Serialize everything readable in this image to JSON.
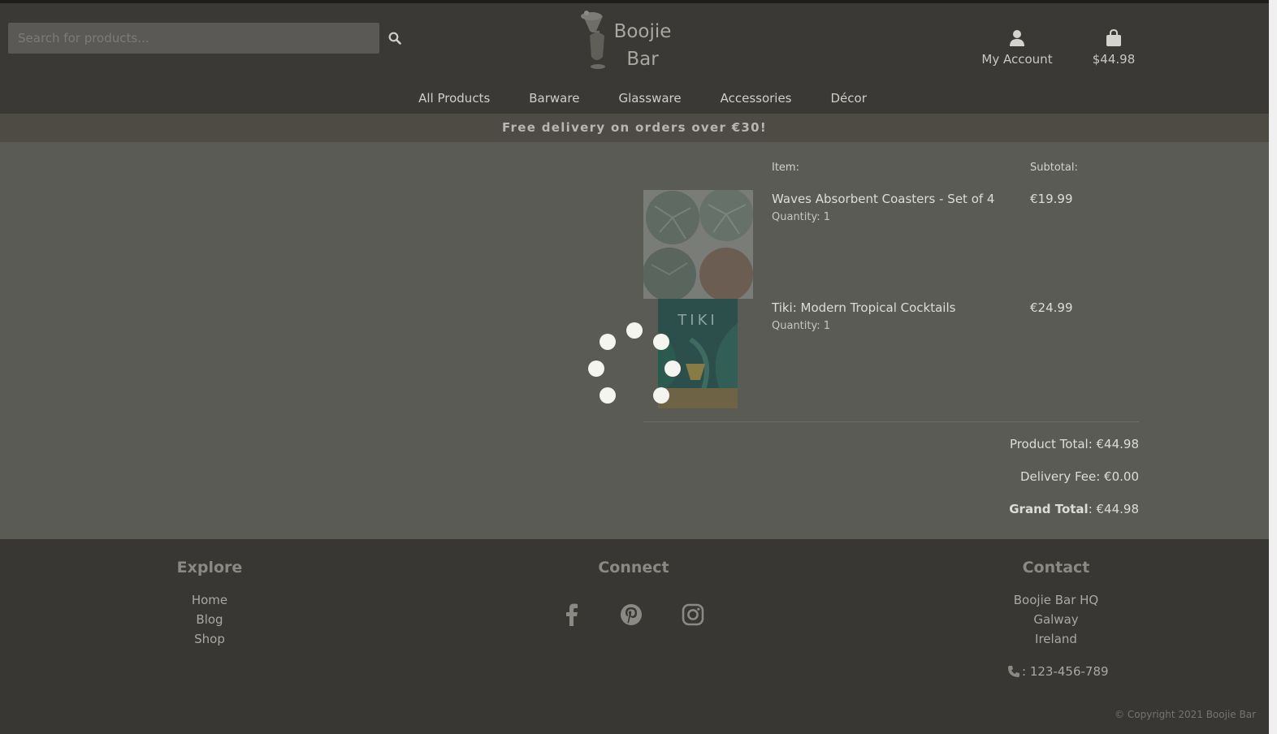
{
  "header": {
    "search_placeholder": "Search for products...",
    "logo_line1": "Boojie",
    "logo_line2": "Bar",
    "account_label": "My Account",
    "cart_total": "$44.98"
  },
  "nav": {
    "items": [
      "All Products",
      "Barware",
      "Glassware",
      "Accessories",
      "Décor"
    ]
  },
  "banner": "Free delivery on orders over €30!",
  "cart": {
    "item_header": "Item:",
    "subtotal_header": "Subtotal:",
    "items": [
      {
        "name": "Waves Absorbent Coasters - Set of 4",
        "quantity": "Quantity: 1",
        "price": "€19.99"
      },
      {
        "name": "Tiki: Modern Tropical Cocktails",
        "quantity": "Quantity: 1",
        "price": "€24.99",
        "cover_text": "TIKI"
      }
    ],
    "product_total": "Product Total: €44.98",
    "delivery_fee": "Delivery Fee: €0.00",
    "grand_total_label": "Grand Total",
    "grand_total_value": ": €44.98"
  },
  "footer": {
    "explore_title": "Explore",
    "explore_links": [
      "Home",
      "Blog",
      "Shop"
    ],
    "connect_title": "Connect",
    "social_icons": [
      "facebook-icon",
      "pinterest-icon",
      "instagram-icon"
    ],
    "contact_title": "Contact",
    "contact_lines": [
      "Boojie Bar HQ",
      "Galway",
      "Ireland"
    ],
    "phone": ": 123-456-789",
    "copyright": "© Copyright 2021 Boojie Bar"
  },
  "colors": {
    "header_bg": "#3a3936",
    "overlay_body": "#5b5b56",
    "footer_bg": "#383734",
    "spinner": "#f4f4f0"
  }
}
